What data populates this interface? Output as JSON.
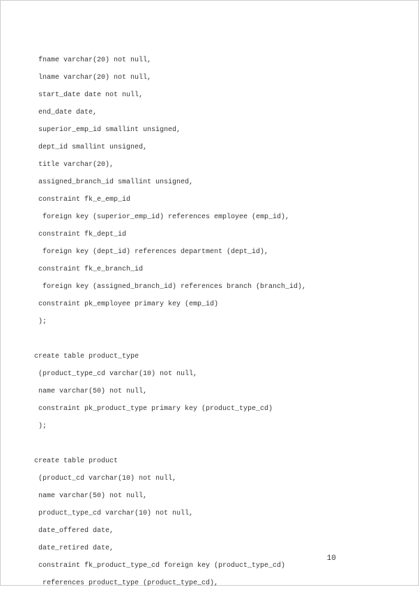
{
  "code": {
    "lines": [
      {
        "indent": 1,
        "text": "fname varchar(20) not null,"
      },
      {
        "indent": 1,
        "text": "lname varchar(20) not null,"
      },
      {
        "indent": 1,
        "text": "start_date date not null,"
      },
      {
        "indent": 1,
        "text": "end_date date,"
      },
      {
        "indent": 1,
        "text": "superior_emp_id smallint unsigned,"
      },
      {
        "indent": 1,
        "text": "dept_id smallint unsigned,"
      },
      {
        "indent": 1,
        "text": "title varchar(20),"
      },
      {
        "indent": 1,
        "text": "assigned_branch_id smallint unsigned,"
      },
      {
        "indent": 1,
        "text": "constraint fk_e_emp_id"
      },
      {
        "indent": 2,
        "text": "foreign key (superior_emp_id) references employee (emp_id),"
      },
      {
        "indent": 1,
        "text": "constraint fk_dept_id"
      },
      {
        "indent": 2,
        "text": "foreign key (dept_id) references department (dept_id),"
      },
      {
        "indent": 1,
        "text": "constraint fk_e_branch_id"
      },
      {
        "indent": 2,
        "text": "foreign key (assigned_branch_id) references branch (branch_id),"
      },
      {
        "indent": 1,
        "text": "constraint pk_employee primary key (emp_id)"
      },
      {
        "indent": 1,
        "text": ");"
      },
      {
        "indent": 0,
        "text": " "
      },
      {
        "indent": 0,
        "text": "create table product_type"
      },
      {
        "indent": 1,
        "text": "(product_type_cd varchar(10) not null,"
      },
      {
        "indent": 1,
        "text": "name varchar(50) not null,"
      },
      {
        "indent": 1,
        "text": "constraint pk_product_type primary key (product_type_cd)"
      },
      {
        "indent": 1,
        "text": ");"
      },
      {
        "indent": 0,
        "text": " "
      },
      {
        "indent": 0,
        "text": "create table product"
      },
      {
        "indent": 1,
        "text": "(product_cd varchar(10) not null,"
      },
      {
        "indent": 1,
        "text": "name varchar(50) not null,"
      },
      {
        "indent": 1,
        "text": "product_type_cd varchar(10) not null,"
      },
      {
        "indent": 1,
        "text": "date_offered date,"
      },
      {
        "indent": 1,
        "text": "date_retired date,"
      },
      {
        "indent": 1,
        "text": "constraint fk_product_type_cd foreign key (product_type_cd)"
      },
      {
        "indent": 2,
        "text": "references product_type (product_type_cd),"
      }
    ]
  },
  "page_number": "10"
}
